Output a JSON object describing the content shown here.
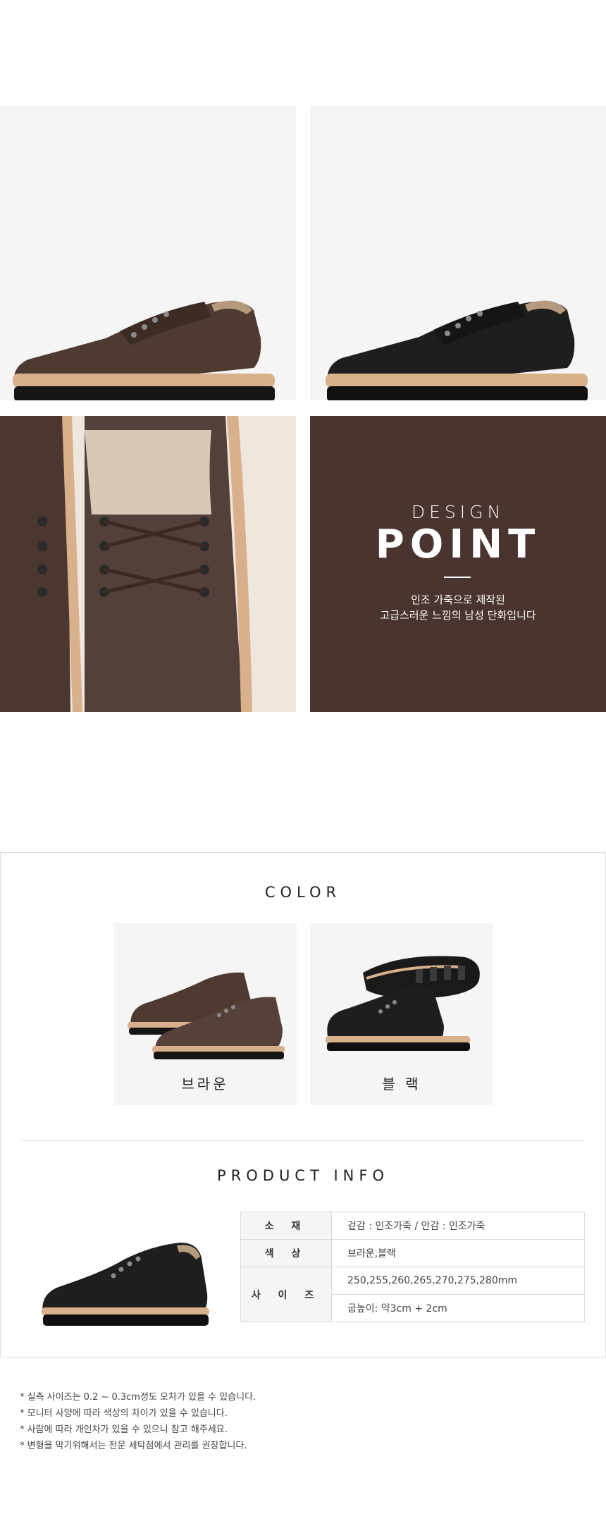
{
  "design_point": {
    "eyebrow": "DESIGN",
    "title": "POINT",
    "desc_line1": "인조 가죽으로 제작된",
    "desc_line2": "고급스러운 느낌의 남성 단화입니다"
  },
  "color_section": {
    "title": "COLOR",
    "options": [
      {
        "label": "브라운",
        "hex": "#4e3a31"
      },
      {
        "label": "블 랙",
        "hex": "#1e1e1e"
      }
    ]
  },
  "product_info": {
    "title": "PRODUCT INFO",
    "rows": [
      {
        "key": "소 재",
        "value": "겉감 : 인조가죽 / 안감 : 인조가죽"
      },
      {
        "key": "색 상",
        "value": "브라운,블랙"
      },
      {
        "key": "사 이 즈",
        "value": "250,255,260,265,270,275,280mm",
        "value2": "굽높이: 약3cm + 2cm"
      }
    ]
  },
  "notes": [
    "* 실측 사이즈는 0.2 ~ 0.3cm정도 오차가 있을 수 있습니다.",
    "* 모니터 사양에 따라 색상의 차이가 있을 수 있습니다.",
    "* 사람에 따라 개인차가 있을 수 있으니 참고 해주세요.",
    "* 변형을 막기위해서는 전문 세탁점에서 관리를 권장합니다."
  ],
  "colors": {
    "brown": "#4e3a31",
    "black": "#1e1e1e",
    "panel": "#4a3430",
    "sole_stitch": "#d9b08c"
  }
}
